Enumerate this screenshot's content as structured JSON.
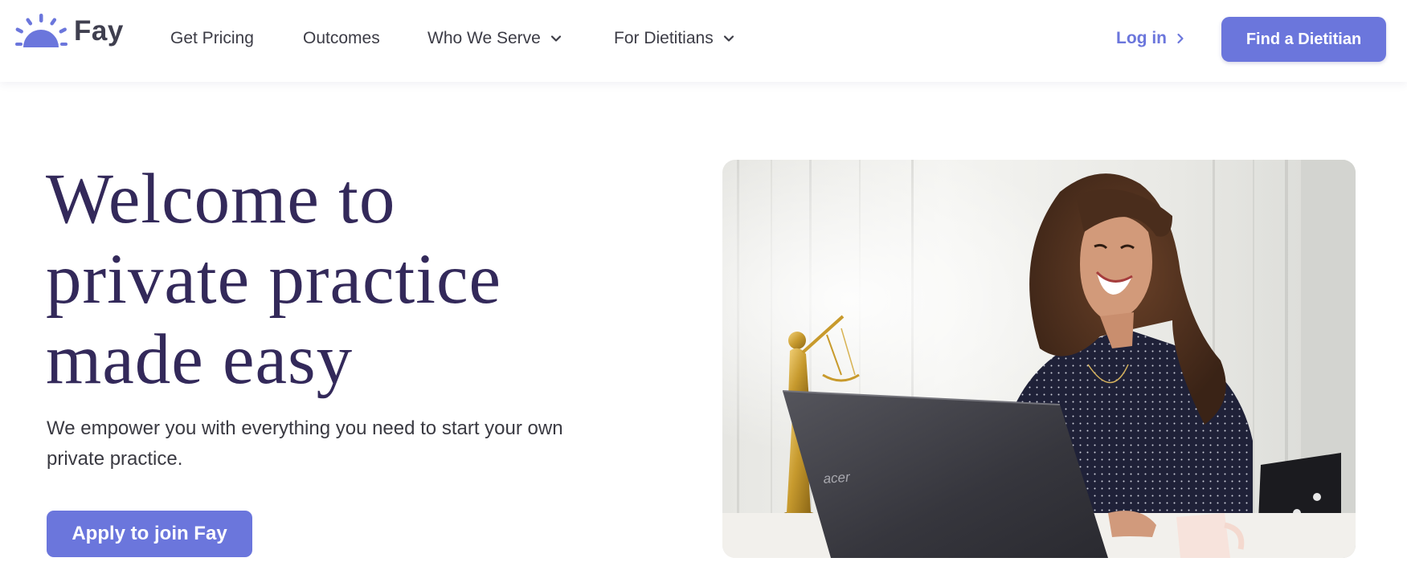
{
  "header": {
    "logo_text": "Fay",
    "nav": [
      {
        "label": "Get Pricing",
        "has_dropdown": false
      },
      {
        "label": "Outcomes",
        "has_dropdown": false
      },
      {
        "label": "Who We Serve",
        "has_dropdown": true
      },
      {
        "label": "For Dietitians",
        "has_dropdown": true
      }
    ],
    "login_label": "Log in",
    "cta_label": "Find a Dietitian"
  },
  "hero": {
    "headline_lines": [
      "Welcome to",
      "private practice",
      "made easy"
    ],
    "subtext": "We empower you with everything you need to start your own private practice.",
    "cta_label": "Apply to join Fay",
    "laptop_brand": "acer"
  },
  "colors": {
    "accent": "#6b76dc",
    "headline": "#33295a",
    "body_text": "#3a3a42",
    "nav_text": "#3c3c46"
  },
  "icons": {
    "logo": "sun-icon",
    "dropdown": "chevron-down-icon",
    "login_arrow": "chevron-right-icon"
  }
}
